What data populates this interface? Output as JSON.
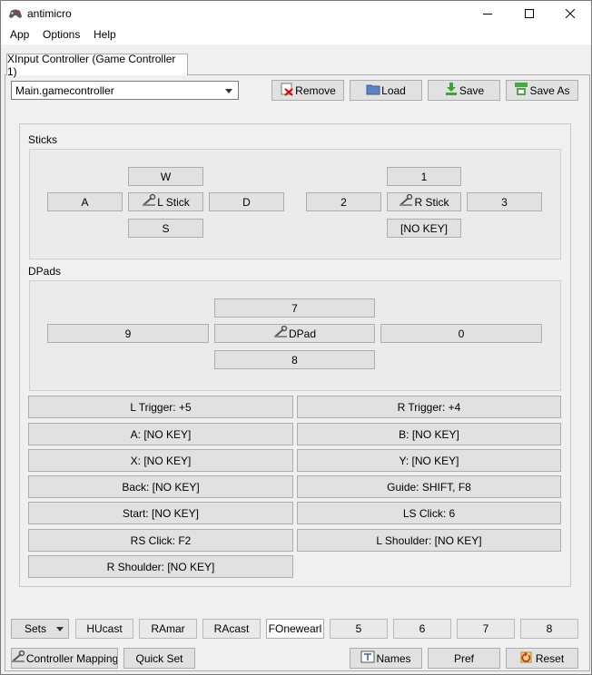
{
  "window": {
    "title": "antimicro"
  },
  "menu": [
    {
      "label": "App"
    },
    {
      "label": "Options"
    },
    {
      "label": "Help"
    }
  ],
  "tab": {
    "label": "XInput Controller (Game Controller 1)"
  },
  "profile": {
    "selected": "Main.gamecontroller"
  },
  "toolbar": {
    "remove": "Remove",
    "load": "Load",
    "save": "Save",
    "save_as": "Save As"
  },
  "sticks": {
    "label": "Sticks",
    "left": {
      "up": "W",
      "left": "A",
      "center": "L Stick",
      "right": "D",
      "down": "S"
    },
    "right": {
      "up": "1",
      "left": "2",
      "center": "R Stick",
      "right": "3",
      "down": "[NO KEY]"
    }
  },
  "dpads": {
    "label": "DPads",
    "up": "7",
    "left": "9",
    "center": "DPad",
    "right": "0",
    "down": "8"
  },
  "buttons": {
    "l_trigger": "L Trigger: +5",
    "r_trigger": "R Trigger: +4",
    "a": "A: [NO KEY]",
    "b": "B: [NO KEY]",
    "x": "X: [NO KEY]",
    "y": "Y: [NO KEY]",
    "back": "Back: [NO KEY]",
    "guide": "Guide: SHIFT, F8",
    "start": "Start: [NO KEY]",
    "ls_click": "LS Click: 6",
    "rs_click": "RS Click: F2",
    "l_shoulder": "L Shoulder: [NO KEY]",
    "r_shoulder": "R Shoulder: [NO KEY]"
  },
  "sets": {
    "label": "Sets",
    "items": [
      "HUcast",
      "RAmar",
      "RAcast",
      "FOnewearl",
      "5",
      "6",
      "7",
      "8"
    ]
  },
  "bottom": {
    "controller_mapping": "Controller Mapping",
    "quick_set": "Quick Set",
    "names": "Names",
    "pref": "Pref",
    "reset": "Reset"
  }
}
